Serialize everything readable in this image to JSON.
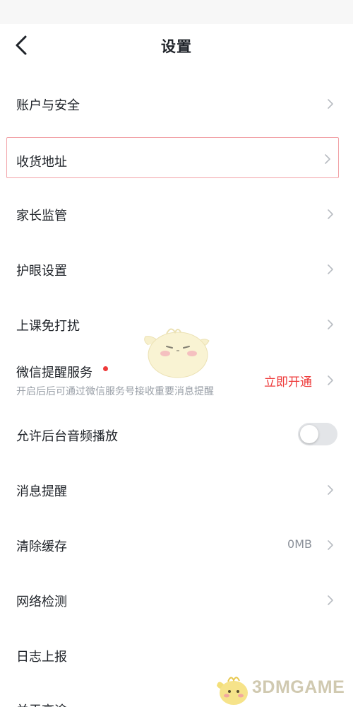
{
  "header": {
    "title": "设置",
    "back_icon": "chevron-left-icon"
  },
  "settings": {
    "account_security": "账户与安全",
    "shipping_address": "收货地址",
    "parental_control": "家长监管",
    "eye_protection": "护眼设置",
    "class_do_not_disturb": "上课免打扰",
    "wechat_reminder": {
      "label": "微信提醒服务",
      "description": "开启后后可通过微信服务号接收重要消息提醒",
      "action": "立即开通",
      "badge_color": "#ee3a3a"
    },
    "background_audio": {
      "label": "允许后台音频播放",
      "enabled": false
    },
    "message_notification": "消息提醒",
    "clear_cache": {
      "label": "清除缓存",
      "value": "0MB"
    },
    "network_test": "网络检测",
    "log_report": "日志上报",
    "about": "关于高途"
  },
  "watermark": {
    "text": "3DMGAME"
  },
  "colors": {
    "accent_red": "#ee3a3a",
    "text_primary": "#1f2329",
    "text_secondary": "#9aa0a8",
    "chevron": "#b8bcc2"
  }
}
